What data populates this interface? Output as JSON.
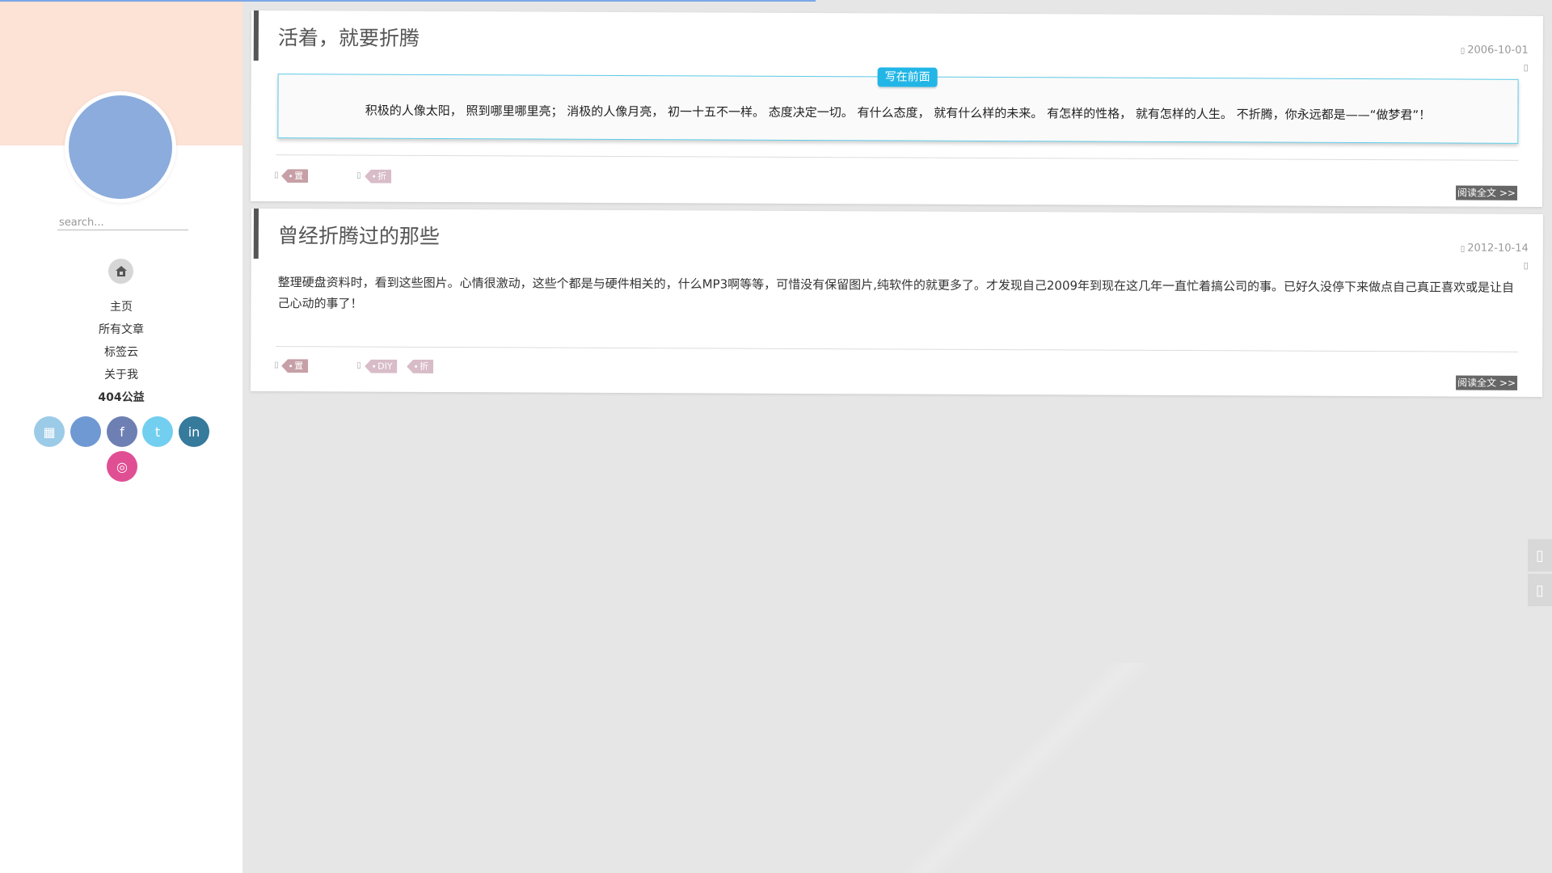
{
  "sidebar": {
    "search_placeholder": "search...",
    "nav": [
      {
        "label": "主页"
      },
      {
        "label": "所有文章"
      },
      {
        "label": "标签云"
      },
      {
        "label": "关于我"
      },
      {
        "label": "404公益"
      }
    ],
    "socials": [
      {
        "name": "grid-icon",
        "glyph": "▦",
        "color": "#9ccbe8"
      },
      {
        "name": "github-icon",
        "glyph": "",
        "color": "#6f99d3"
      },
      {
        "name": "facebook-icon",
        "glyph": "f",
        "color": "#6d7fb3"
      },
      {
        "name": "twitter-icon",
        "glyph": "t",
        "color": "#72cff0"
      },
      {
        "name": "linkedin-icon",
        "glyph": "in",
        "color": "#367a9c"
      },
      {
        "name": "instagram-icon",
        "glyph": "◎",
        "color": "#e04f93"
      }
    ]
  },
  "posts": [
    {
      "title": "活着，就要折腾",
      "date": "2006-10-01",
      "note_label": "写在前面",
      "excerpt": "积极的人像太阳， 照到哪里哪里亮； 消极的人像月亮， 初一十五不一样。 态度决定一切。 有什么态度， 就有什么样的未来。 有怎样的性格， 就有怎样的人生。 不折腾，你永远都是——“做梦君”！",
      "category_tags": [
        "置顶"
      ],
      "tags": [
        "折腾"
      ],
      "read_more": "阅读全文 >>"
    },
    {
      "title": "曾经折腾过的那些",
      "date": "2012-10-14",
      "excerpt": "整理硬盘资料时，看到这些图片。心情很激动，这些个都是与硬件相关的，什么MP3啊等等，可惜没有保留图片,纯软件的就更多了。才发现自己2009年到现在这几年一直忙着搞公司的事。已好久没停下来做点自己真正喜欢或是让自己心动的事了！",
      "category_tags": [
        "置顶"
      ],
      "tags": [
        "DIY",
        "折腾"
      ],
      "read_more": "阅读全文 >>"
    }
  ],
  "colors": {
    "accent": "#22b6e6",
    "banner": "#fde2d6",
    "avatar": "#8bacdc"
  }
}
